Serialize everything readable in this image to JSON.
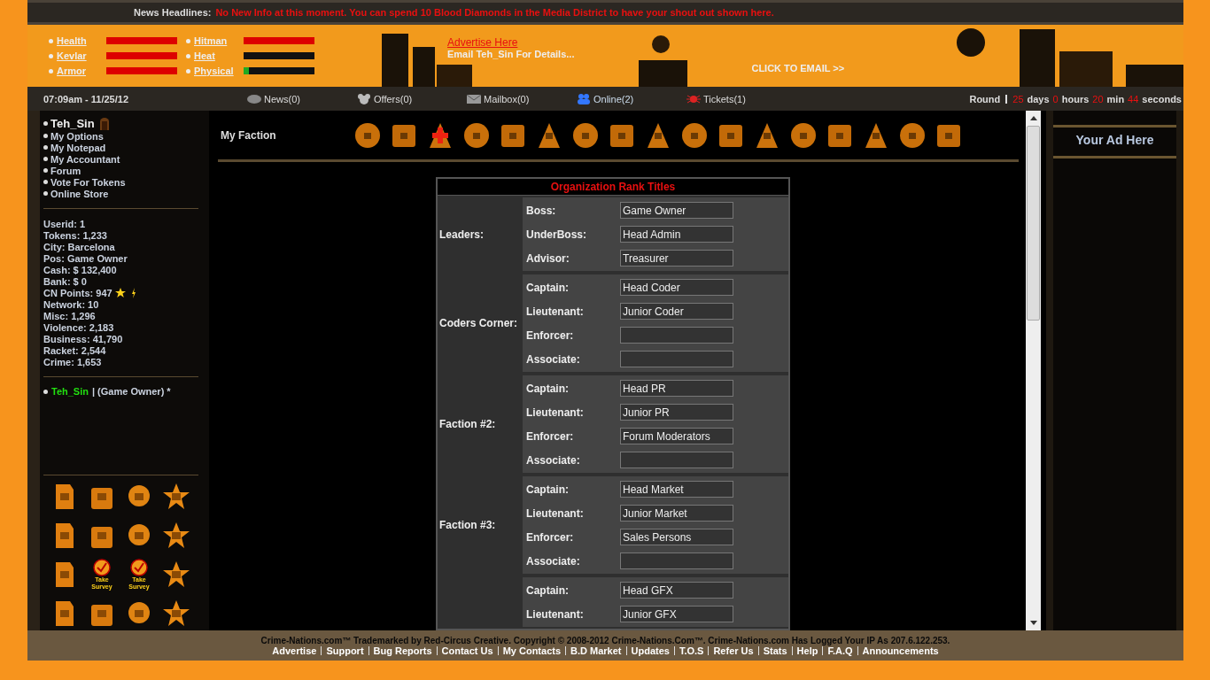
{
  "news": {
    "label": "News Headlines:",
    "text": "No New Info at this moment. You can spend 10 Blood Diamonds in the Media District to have your shout out shown here."
  },
  "banner_stats": [
    {
      "label": "Health",
      "level": 1,
      "color": "#dd0000"
    },
    {
      "label": "Kevlar",
      "level": 1,
      "color": "#dd0000"
    },
    {
      "label": "Armor",
      "level": 1,
      "color": "#dd0000"
    },
    {
      "label": "Hitman",
      "level": 1,
      "color": "#dd0000"
    },
    {
      "label": "Heat"
    },
    {
      "label": "Physical",
      "level": 0.08,
      "color": "#22aa22"
    }
  ],
  "ad": {
    "link": "Advertise Here",
    "text": "Email Teh_Sin For Details...",
    "email": "CLICK TO EMAIL >>"
  },
  "status_bar": {
    "time": "07:09am - 11/25/12",
    "links": [
      {
        "kind": "news",
        "label": "News(0)"
      },
      {
        "kind": "offers",
        "label": "Offers(0)"
      },
      {
        "kind": "mail",
        "label": "Mailbox(0)"
      },
      {
        "kind": "online",
        "label": "Online(2)"
      },
      {
        "kind": "tickets",
        "label": "Tickets(1)"
      }
    ],
    "round": {
      "label": "Round",
      "parts": [
        {
          "value": "25",
          "unit": "days"
        },
        {
          "value": "0",
          "unit": "hours"
        },
        {
          "value": "20",
          "unit": "min"
        },
        {
          "value": "44",
          "unit": "seconds"
        }
      ]
    }
  },
  "sidebar": {
    "user": "Teh_Sin",
    "menu": [
      "My Options",
      "My Notepad",
      "My Accountant",
      "Forum",
      "Vote For Tokens",
      "Online Store"
    ],
    "stats": [
      {
        "text": "Userid: 1"
      },
      {
        "text": "Tokens: 1,233"
      },
      {
        "text": "City: Barcelona"
      },
      {
        "text": "Pos: Game Owner"
      },
      {
        "text": "Cash: $ 132,400"
      },
      {
        "text": "Bank: $ 0"
      },
      {
        "text": "CN Points: 947",
        "kind": "points"
      },
      {
        "text": "Network: 10"
      },
      {
        "text": "Misc: 1,296"
      },
      {
        "text": "Violence: 2,183"
      },
      {
        "text": "Business: 41,790"
      },
      {
        "text": "Racket: 2,544"
      },
      {
        "text": "Crime: 1,653"
      }
    ],
    "online": {
      "name": "Teh_Sin",
      "text": "| (Game Owner) *"
    },
    "survey_labels": [
      "Take Survey",
      "Take Survey"
    ]
  },
  "page_title": "My Faction",
  "table": {
    "title": "Organization Rank Titles",
    "groups": [
      {
        "label": "Leaders:",
        "ranks": [
          {
            "rank": "Boss:",
            "value": "Game Owner"
          },
          {
            "rank": "UnderBoss:",
            "value": "Head Admin"
          },
          {
            "rank": "Advisor:",
            "value": "Treasurer"
          }
        ]
      },
      {
        "label": "Coders Corner:",
        "ranks": [
          {
            "rank": "Captain:",
            "value": "Head Coder"
          },
          {
            "rank": "Lieutenant:",
            "value": "Junior Coder"
          },
          {
            "rank": "Enforcer:"
          },
          {
            "rank": "Associate:"
          }
        ]
      },
      {
        "label": "Faction #2:",
        "ranks": [
          {
            "rank": "Captain:",
            "value": "Head PR"
          },
          {
            "rank": "Lieutenant:",
            "value": "Junior PR"
          },
          {
            "rank": "Enforcer:",
            "value": "Forum Moderators"
          },
          {
            "rank": "Associate:"
          }
        ]
      },
      {
        "label": "Faction #3:",
        "ranks": [
          {
            "rank": "Captain:",
            "value": "Head Market"
          },
          {
            "rank": "Lieutenant:",
            "value": "Junior Market"
          },
          {
            "rank": "Enforcer:",
            "value": "Sales Persons"
          },
          {
            "rank": "Associate:"
          }
        ]
      },
      {
        "ranks": [
          {
            "rank": "Captain:",
            "value": "Head GFX"
          },
          {
            "rank": "Lieutenant:",
            "value": "Junior GFX"
          }
        ]
      }
    ]
  },
  "right_ad": "Your Ad Here",
  "footer": {
    "copyright": "Crime-Nations.com™ Trademarked by Red-Circus Creative. Copyright © 2008-2012 Crime-Nations.Com™. Crime-Nations.com Has Logged Your IP As 207.6.122.253.",
    "links": [
      "Advertise",
      "Support",
      "Bug Reports",
      "Contact Us",
      "My Contacts",
      "B.D Market",
      "Updates",
      "T.O.S",
      "Refer Us",
      "Stats",
      "Help",
      "F.A.Q",
      "Announcements"
    ]
  }
}
